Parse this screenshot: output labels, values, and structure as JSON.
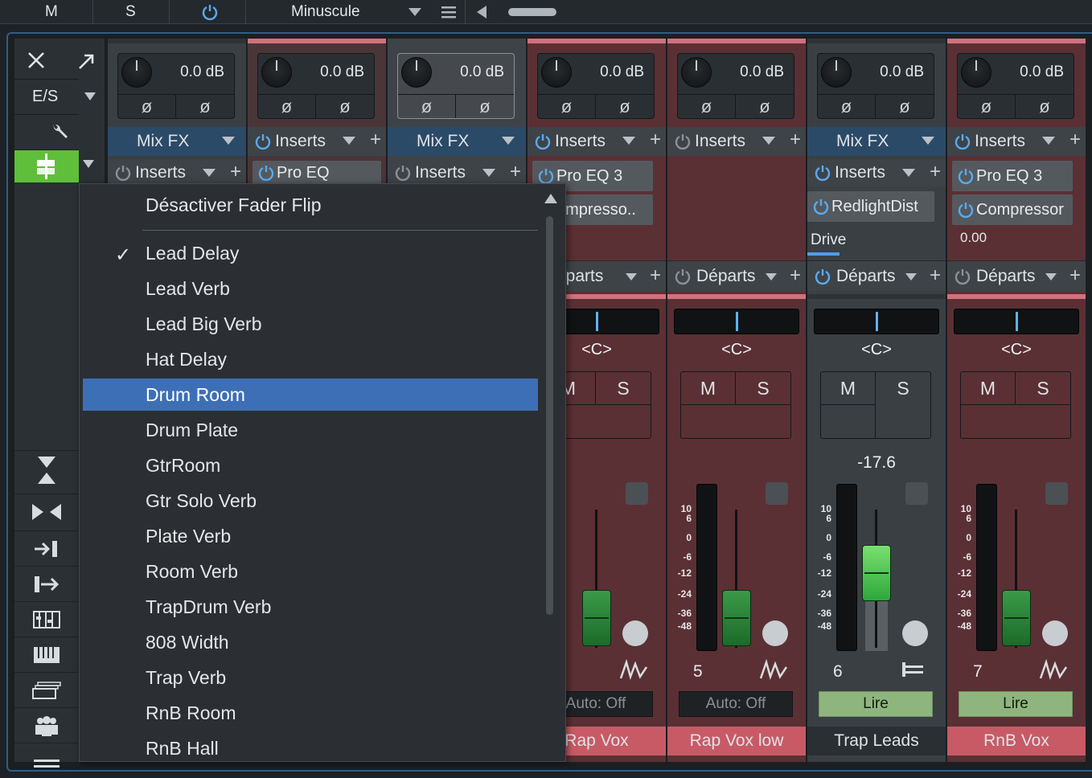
{
  "topbar": {
    "mute_label": "M",
    "solo_label": "S",
    "size_label": "Minuscule"
  },
  "toolbar": {
    "es_label": "E/S"
  },
  "menu": {
    "header": "Désactiver Fader Flip",
    "items": [
      {
        "label": "Lead Delay",
        "checked": true
      },
      {
        "label": "Lead Verb"
      },
      {
        "label": "Lead Big Verb"
      },
      {
        "label": "Hat Delay"
      },
      {
        "label": "Drum Room",
        "highlighted": true
      },
      {
        "label": "Drum Plate"
      },
      {
        "label": "GtrRoom"
      },
      {
        "label": "Gtr Solo Verb"
      },
      {
        "label": "Plate Verb"
      },
      {
        "label": "Room Verb"
      },
      {
        "label": "TrapDrum Verb"
      },
      {
        "label": "808 Width"
      },
      {
        "label": "Trap Verb"
      },
      {
        "label": "RnB Room"
      },
      {
        "label": "RnB Hall"
      }
    ]
  },
  "strips": [
    {
      "db": "0.0 dB",
      "fx": "Mix FX",
      "inserts": "Inserts"
    },
    {
      "db": "0.0 dB",
      "fx": "Inserts",
      "slot1": "Pro EQ"
    },
    {
      "db": "0.0 dB",
      "fx": "Mix FX",
      "inserts": "Inserts"
    },
    {
      "db": "0.0 dB",
      "fx": "Inserts",
      "slot1": "Pro EQ 3",
      "slot2": "ompresso..",
      "sends": "éparts",
      "pan": "<C>",
      "mute": "M",
      "solo": "S",
      "auto": "Auto: Off",
      "name": "Rap Vox"
    },
    {
      "db": "0.0 dB",
      "fx": "Inserts",
      "sends": "Départs",
      "pan": "<C>",
      "mute": "M",
      "solo": "S",
      "num": "5",
      "auto": "Auto: Off",
      "name": "Rap Vox low"
    },
    {
      "db": "0.0 dB",
      "fx": "Mix FX",
      "inserts": "Inserts",
      "slot1": "RedlightDist",
      "param": "Drive",
      "sends": "Départs",
      "pan": "<C>",
      "mute": "M",
      "solo": "S",
      "gain": "-17.6",
      "num": "6",
      "auto": "Lire",
      "name": "Trap Leads"
    },
    {
      "db": "0.0 dB",
      "fx": "Inserts",
      "slot1": "Pro EQ 3",
      "slot2": "Compressor",
      "param_val": "0.00",
      "sends": "Départs",
      "pan": "<C>",
      "mute": "M",
      "solo": "S",
      "num": "7",
      "auto": "Lire",
      "name": "RnB Vox"
    }
  ],
  "meter_scale": [
    "10",
    "6",
    "0",
    "-6",
    "-12",
    "-24",
    "-36",
    "-48"
  ],
  "colors": {
    "accent": "#3d6fb6",
    "red_strip": "#5a3034",
    "name_red": "#c85a66",
    "fader_green": "#2e8a3c"
  }
}
